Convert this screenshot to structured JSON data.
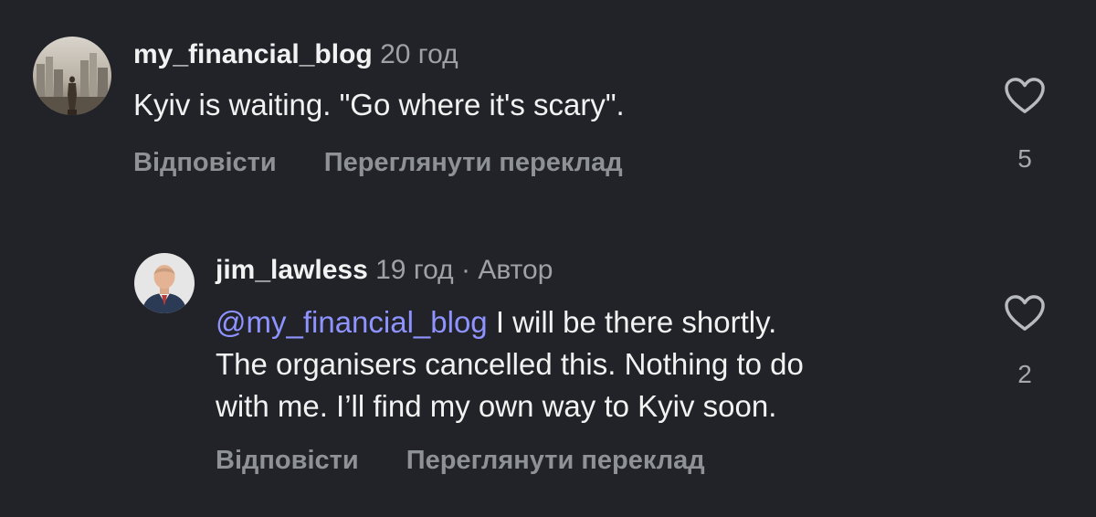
{
  "comments": [
    {
      "username": "my_financial_blog",
      "time": "20 год",
      "text": "Kyiv is waiting. \"Go where it's scary\".",
      "reply_label": "Відповісти",
      "translate_label": "Переглянути переклад",
      "likes": "5",
      "avatar_icon": "city-skyline-avatar"
    },
    {
      "username": "jim_lawless",
      "time": "19 год",
      "separator": "·",
      "author_badge": "Автор",
      "mention": "@my_financial_blog",
      "text_line1": " I will be there shortly.",
      "text_line2": "The organisers cancelled this. Nothing to do",
      "text_line3": "with me. I’ll find my own way to Kyiv soon.",
      "reply_label": "Відповісти",
      "translate_label": "Переглянути переклад",
      "likes": "2",
      "avatar_icon": "man-in-suit-avatar"
    }
  ],
  "colors": {
    "background": "#212328",
    "text": "#f2f2f2",
    "secondary": "#9ea1a6",
    "mention": "#8f93ff"
  }
}
